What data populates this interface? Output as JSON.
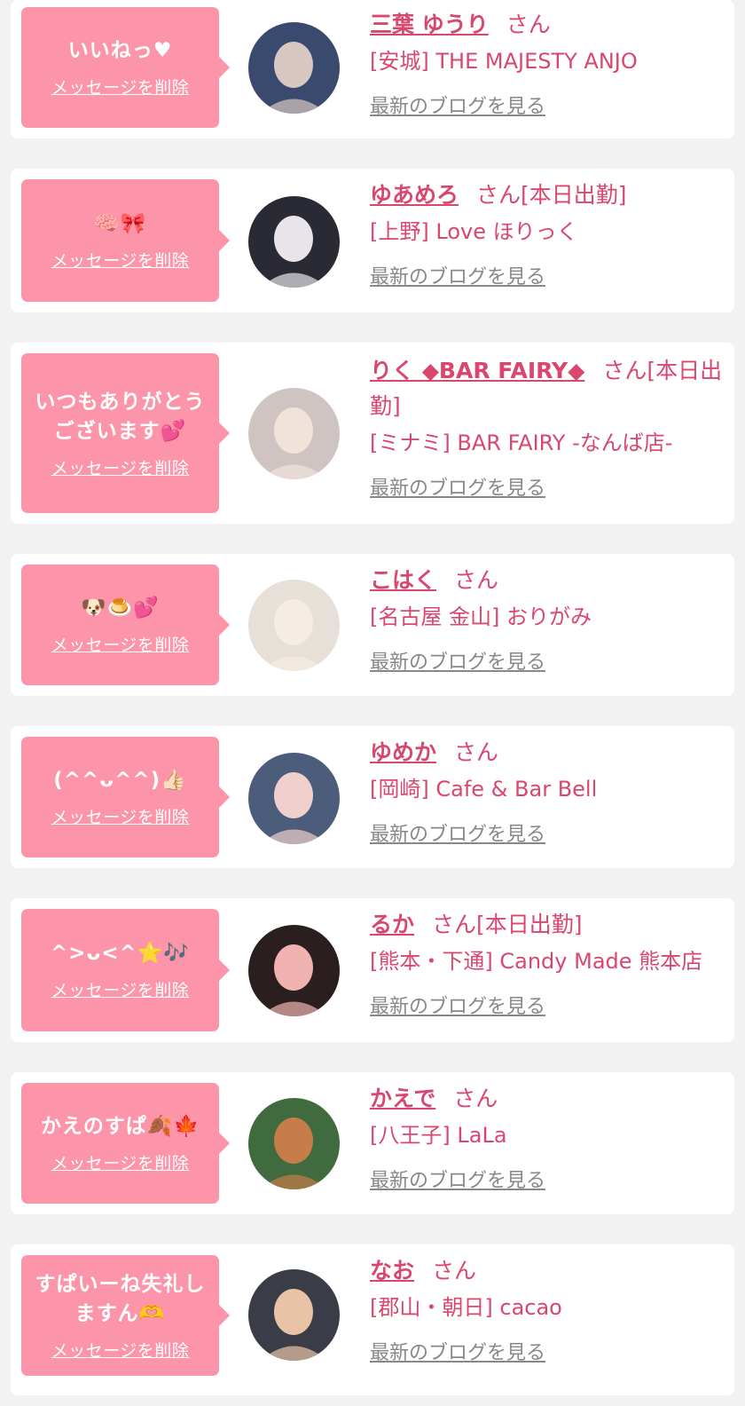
{
  "delete_label": "メッセージを削除",
  "blog_label": "最新のブログを見る",
  "honorific": "さん",
  "today_label": "[本日出勤]",
  "colors": {
    "accent": "#d9476f",
    "bubble": "#fc95a9",
    "card": "#ffffff",
    "background": "#f2f2f2",
    "link_gray": "#888888"
  },
  "items": [
    {
      "message": "いいねっ♥",
      "name": "三葉 ゆうり",
      "working_today": false,
      "area": "[安城]",
      "shop": "THE MAJESTY ANJO",
      "avatar": "photo-portrait"
    },
    {
      "message": "🧠🎀",
      "name": "ゆあめろ",
      "working_today": true,
      "area": "[上野]",
      "shop": "Love ほりっく",
      "avatar": "photo-portrait"
    },
    {
      "message": "いつもありがとう\nございます💕",
      "name": "りく ◆BAR FAIRY◆",
      "working_today": true,
      "area": "[ミナミ]",
      "shop": "BAR FAIRY -なんば店-",
      "avatar": "photo-portrait"
    },
    {
      "message": "🐶🍮💕",
      "name": "こはく",
      "working_today": false,
      "area": "[名古屋 金山]",
      "shop": "おりがみ",
      "avatar": "photo-portrait"
    },
    {
      "message": "(^^ᴗ^^)👍🏻",
      "name": "ゆめか",
      "working_today": false,
      "area": "[岡崎]",
      "shop": "Cafe & Bar Bell",
      "avatar": "photo-portrait"
    },
    {
      "message": "^>ᴗ<^⭐🎶",
      "name": "るか",
      "working_today": true,
      "area": "[熊本・下通]",
      "shop": "Candy Made 熊本店",
      "avatar": "photo-portrait"
    },
    {
      "message": "かえのすぱ🍂🍁",
      "name": "かえで",
      "working_today": false,
      "area": "[八王子]",
      "shop": "LaLa",
      "avatar": "photo-portrait"
    },
    {
      "message": "すぱいーね失礼し\nますん🫶",
      "name": "なお",
      "working_today": false,
      "area": "[郡山・朝日]",
      "shop": "cacao",
      "avatar": "photo-portrait"
    }
  ]
}
